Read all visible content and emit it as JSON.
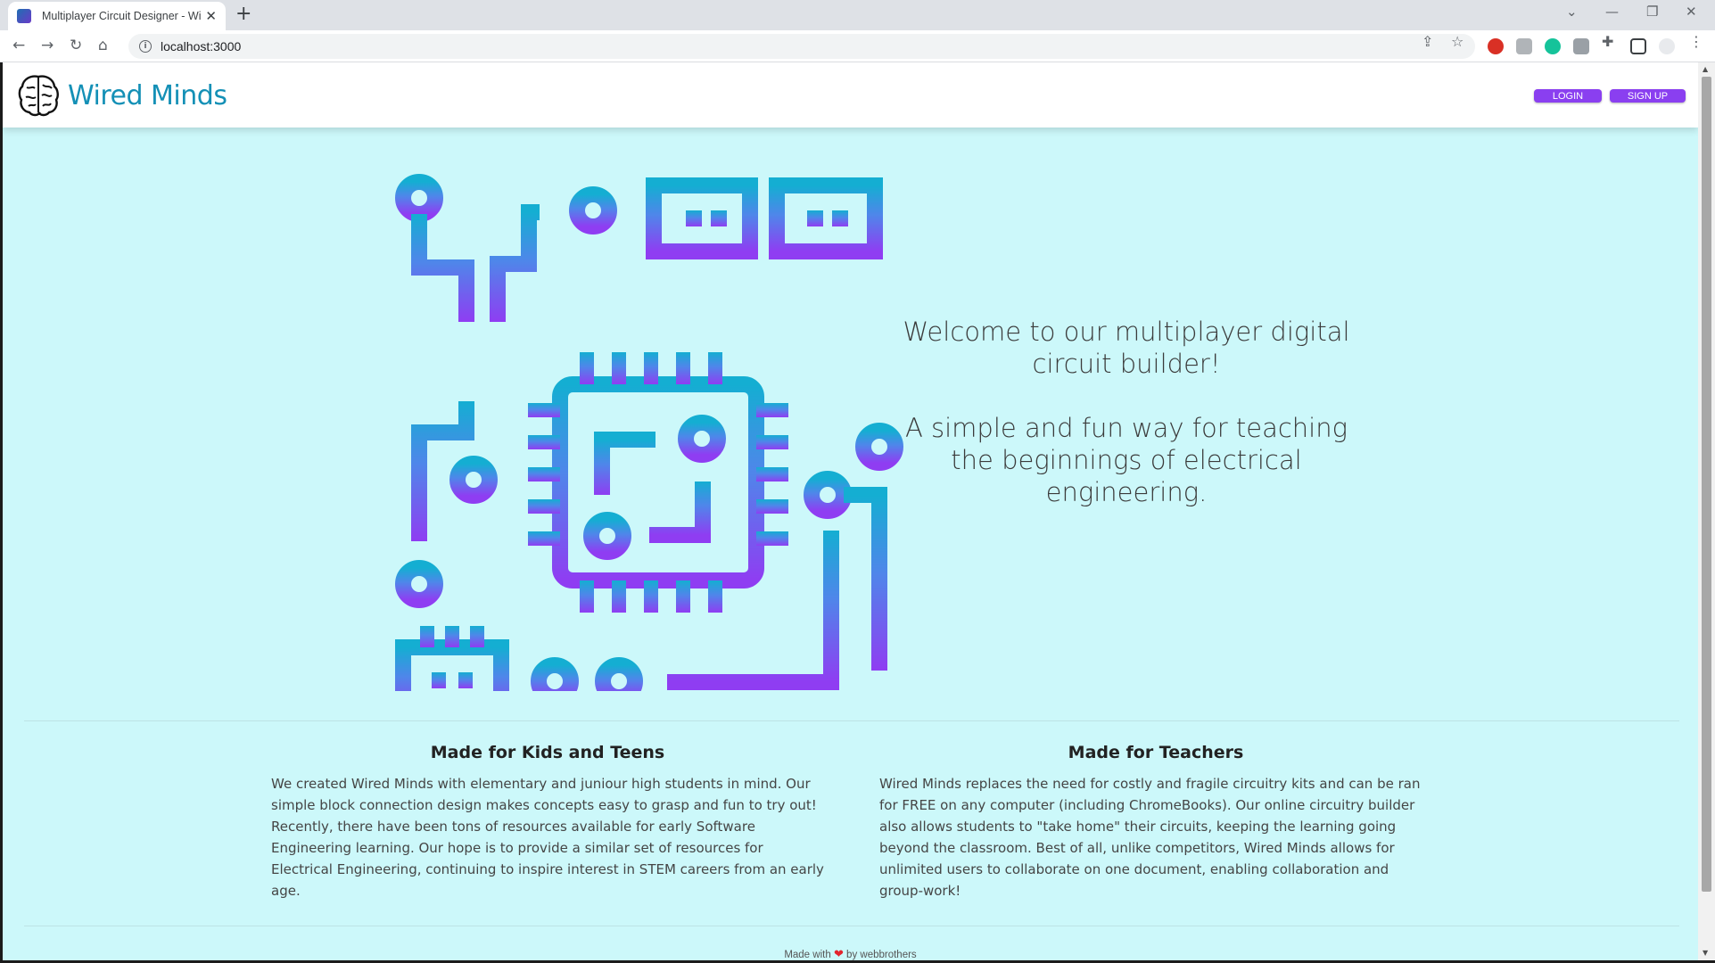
{
  "browser": {
    "tab_title": "Multiplayer Circuit Designer - Wired Minds",
    "url": "localhost:3000"
  },
  "icons": {
    "back": "arrow-left-icon",
    "forward": "arrow-right-icon",
    "reload": "reload-icon",
    "home": "home-icon",
    "share": "share-icon",
    "bookmark": "star-icon",
    "extensions": "puzzle-icon"
  },
  "header": {
    "brand": "Wired Minds",
    "login_label": "LOGIN",
    "signup_label": "SIGN UP"
  },
  "hero": {
    "line1": "Welcome to our multiplayer digital circuit builder!",
    "line2": "A simple and fun way for teaching the beginnings of electrical engineering."
  },
  "features": [
    {
      "title": "Made for Kids and Teens",
      "body": "We created Wired Minds with elementary and juniour high students in mind. Our simple block connection design makes concepts easy to grasp and fun to try out! Recently, there have been tons of resources available for early Software Engineering learning. Our hope is to provide a similar set of resources for Electrical Engineering, continuing to inspire interest in STEM careers from an early age."
    },
    {
      "title": "Made for Teachers",
      "body": "Wired Minds replaces the need for costly and fragile circuitry kits and can be ran for FREE on any computer (including ChromeBooks). Our online circuitry builder also allows students to \"take home\" their circuits, keeping the learning going beyond the classroom. Best of all, unlike competitors, Wired Minds allows for unlimited users to collaborate on one document, enabling collaboration and group-work!"
    }
  ],
  "footer": {
    "made_with": "Made with",
    "by": "by webbrothers"
  },
  "colors": {
    "page_bg": "#ccf8fa",
    "brand": "#1490b6",
    "button": "#8a3ff0",
    "gradient_top": "#1aa8d2",
    "gradient_bottom": "#8b3ff0"
  }
}
